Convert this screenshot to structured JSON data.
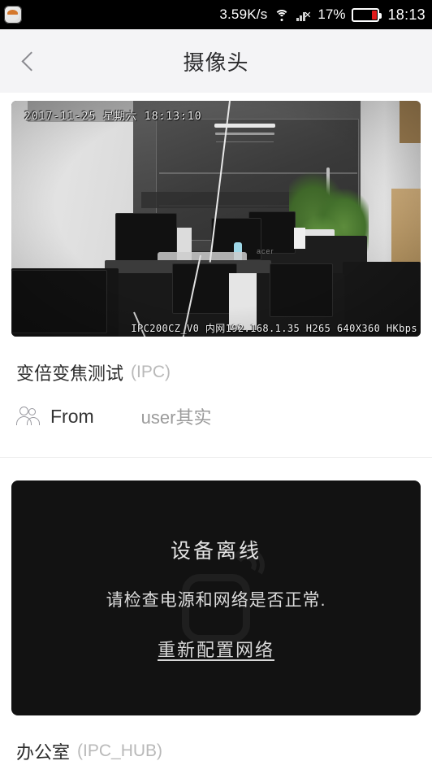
{
  "status_bar": {
    "app_icon": "notification-app-icon",
    "network_speed": "3.59K/s",
    "wifi_icon": "wifi-icon",
    "signal_icon": "signal-no-service-icon",
    "battery_percent": "17%",
    "battery_icon": "battery-low-icon",
    "time": "18:13"
  },
  "nav": {
    "back_icon": "chevron-left-icon",
    "title": "摄像头"
  },
  "camera_card": {
    "osd_timestamp": "2017-11-25 星期六 18:13:10",
    "osd_stream_info": "IPC200CZ_V0 内网192.168.1.35 H265 640X360 HKbps",
    "device_name": "变倍变焦测试",
    "device_tag": "(IPC)",
    "from_icon": "users-icon",
    "from_label": "From",
    "from_value": "user其实"
  },
  "offline_card": {
    "watermark_icon": "camera-device-watermark-icon",
    "title": "设备离线",
    "subtitle": "请检查电源和网络是否正常.",
    "action_link": "重新配置网络",
    "device_name": "办公室",
    "device_tag": "(IPC_HUB)"
  },
  "colors": {
    "status_bar_bg": "#000000",
    "nav_bg": "#f4f4f6",
    "page_bg": "#ffffff",
    "offline_panel_bg": "#121212",
    "muted_text": "#b9b9b9",
    "battery_low": "#e01b1b"
  }
}
